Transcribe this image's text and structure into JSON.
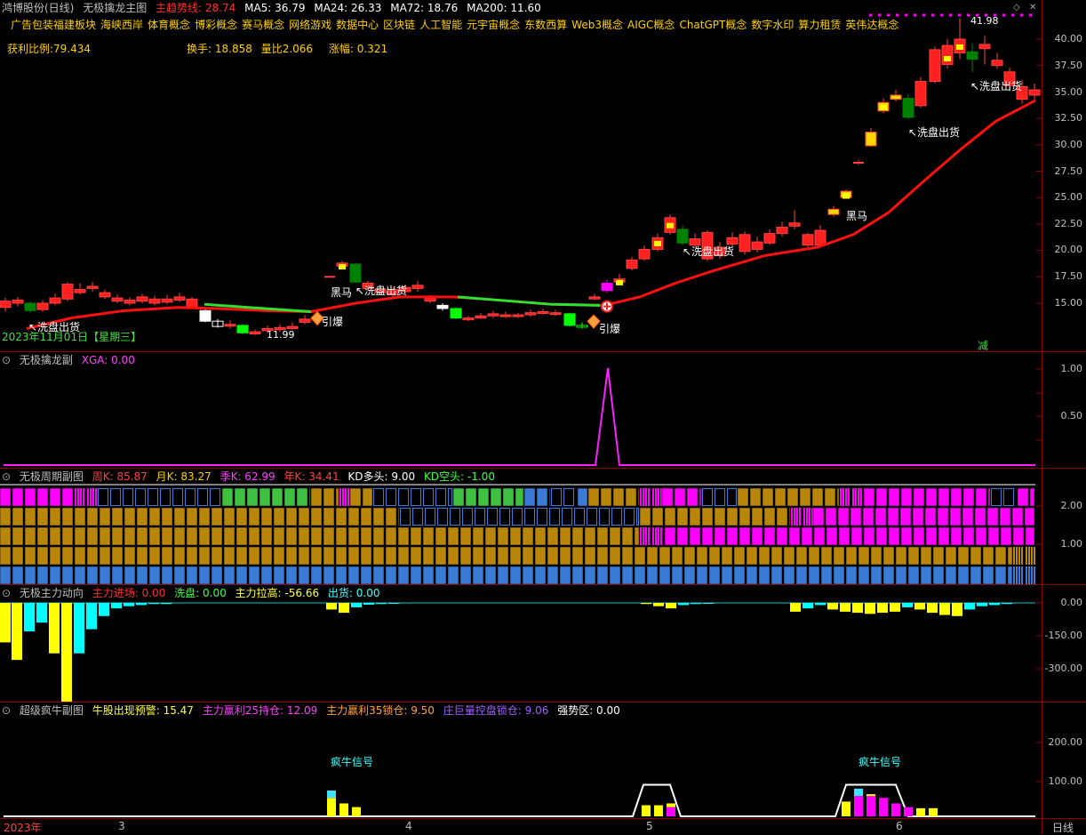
{
  "main": {
    "title_prefix": "鸿博股份(日线)",
    "indicator_name": "无极擒龙主图",
    "trend_label": "主趋势线: 28.74",
    "ma5": "MA5: 36.79",
    "ma24": "MA24: 26.33",
    "ma72": "MA72: 18.76",
    "ma200": "MA200: 11.60",
    "concepts": [
      "广告包装",
      "福建板块",
      "海峡西岸",
      "体育概念",
      "博彩概念",
      "赛马概念",
      "网络游戏",
      "数据中心",
      "区块链",
      "人工智能",
      "元宇宙概念",
      "东数西算",
      "Web3概念",
      "AIGC概念",
      "ChatGPT概念",
      "数字水印",
      "算力租赁",
      "英伟达概念"
    ],
    "profit_ratio": "获利比例:79.434",
    "turnover": "换手: 18.858",
    "vol_ratio": "量比2.066",
    "change": "涨幅: 0.321",
    "date_label": "2023年11月01日【星期三】",
    "high_label": "41.98",
    "low_label": "11.99",
    "annotations": {
      "wash1": "↖洗盘出货",
      "wash2": "↖洗盘出货",
      "wash3": "↖洗盘出货",
      "wash4": "↖洗盘出货",
      "wash5": "↖洗盘出货",
      "darkhorse1": "黑马",
      "darkhorse2": "黑马",
      "burst1": "引爆",
      "burst2": "引爆",
      "reduce": "减"
    },
    "price_ticks": [
      "40.00",
      "37.50",
      "35.00",
      "32.50",
      "30.00",
      "27.50",
      "25.00",
      "22.50",
      "20.00",
      "17.50",
      "15.00"
    ]
  },
  "sub1": {
    "name": "无极擒龙副",
    "xga": "XGA: 0.00",
    "ticks": [
      "1.00",
      "0.50"
    ]
  },
  "sub2": {
    "name": "无极周期副图",
    "week": "周K: 85.87",
    "month": "月K: 83.27",
    "quarter": "季K: 62.99",
    "year": "年K: 34.41",
    "kd_long": "KD多头: 9.00",
    "kd_short": "KD空头: -1.00",
    "ticks": [
      "2.00",
      "1.00"
    ]
  },
  "sub3": {
    "name": "无极主力动向",
    "enter": "主力进场: 0.00",
    "wash": "洗盘: 0.00",
    "pull": "主力拉高: -56.66",
    "out": "出货: 0.00",
    "ticks": [
      "0.00",
      "-150.00",
      "-300.00"
    ]
  },
  "sub4": {
    "name": "超级疯牛副图",
    "warn": "牛股出现预警: 15.47",
    "hold": "主力赢利25持仓: 12.09",
    "lock": "主力赢利35锁仓: 9.50",
    "giant": "庄巨量控盘锁仓: 9.06",
    "strong": "强势区: 0.00",
    "signal1": "疯牛信号",
    "signal2": "疯牛信号",
    "ticks": [
      "200.00",
      "100.00"
    ]
  },
  "bottom": {
    "year": "2023年",
    "m3": "3",
    "m4": "4",
    "m5": "5",
    "m6": "6",
    "period": "日线"
  },
  "colors": {
    "up": "#ff2020",
    "down": "#00a000",
    "yellow": "#ffff00",
    "magenta": "#ff00ff",
    "cyan": "#00ffff",
    "gold": "#b8860b",
    "blue": "#3a7bd5",
    "green": "#40c040"
  }
}
